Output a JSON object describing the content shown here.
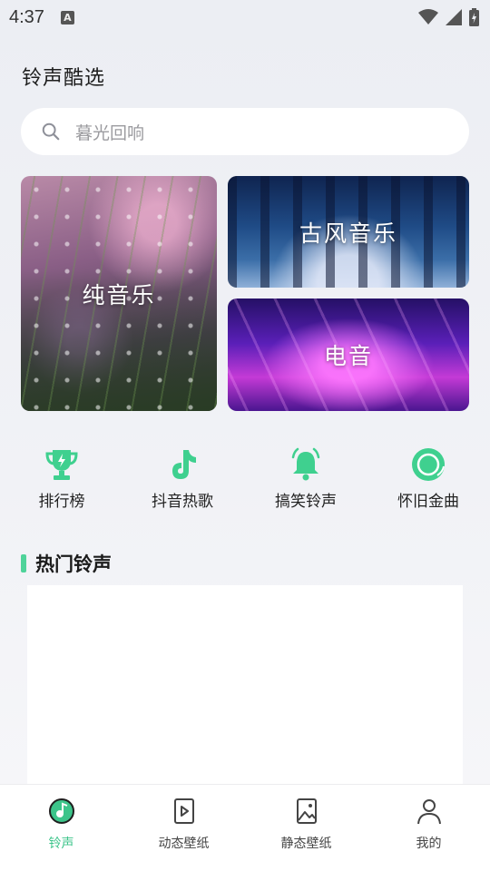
{
  "status_bar": {
    "time": "4:37",
    "notification_icon": "A"
  },
  "page": {
    "title": "铃声酷选"
  },
  "search": {
    "placeholder": "暮光回响"
  },
  "feature_cards": [
    {
      "label": "纯音乐"
    },
    {
      "label": "古风音乐"
    },
    {
      "label": "电音"
    }
  ],
  "categories": [
    {
      "label": "排行榜",
      "icon": "trophy-icon"
    },
    {
      "label": "抖音热歌",
      "icon": "tiktok-icon"
    },
    {
      "label": "搞笑铃声",
      "icon": "bell-icon"
    },
    {
      "label": "怀旧金曲",
      "icon": "vinyl-icon"
    }
  ],
  "hot_section": {
    "title": "热门铃声"
  },
  "bottom_nav": [
    {
      "label": "铃声",
      "icon": "music-disc-icon",
      "active": true
    },
    {
      "label": "动态壁纸",
      "icon": "video-wallpaper-icon",
      "active": false
    },
    {
      "label": "静态壁纸",
      "icon": "image-wallpaper-icon",
      "active": false
    },
    {
      "label": "我的",
      "icon": "user-icon",
      "active": false
    }
  ],
  "colors": {
    "accent": "#3cc48a",
    "background": "#eceef3"
  }
}
